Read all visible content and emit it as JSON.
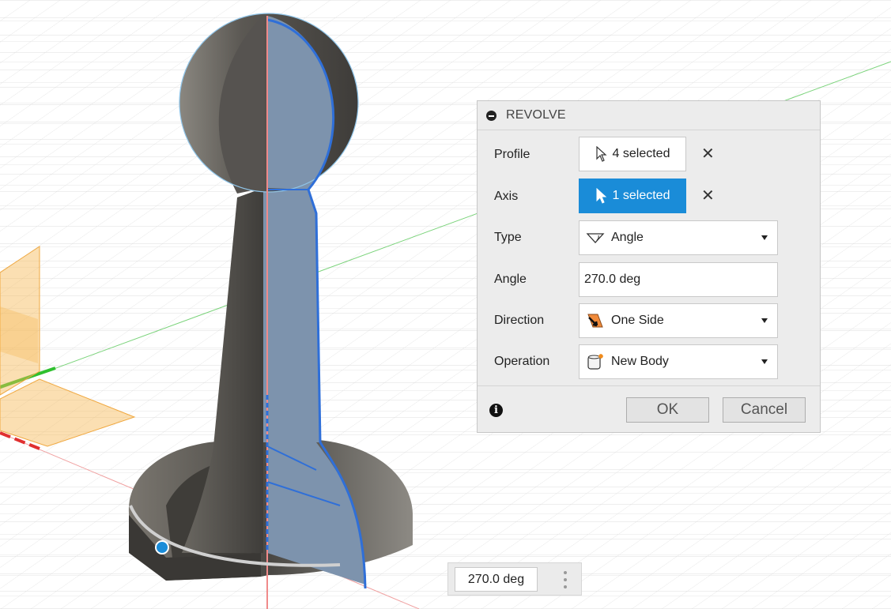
{
  "revolve": {
    "title": "REVOLVE",
    "profile": {
      "label": "Profile",
      "value": "4 selected"
    },
    "axis": {
      "label": "Axis",
      "value": "1 selected"
    },
    "type": {
      "label": "Type",
      "value": "Angle"
    },
    "angle": {
      "label": "Angle",
      "value": "270.0 deg"
    },
    "direction": {
      "label": "Direction",
      "value": "One Side"
    },
    "operation": {
      "label": "Operation",
      "value": "New Body"
    },
    "ok_label": "OK",
    "cancel_label": "Cancel"
  },
  "hud": {
    "angle_value": "270.0 deg"
  },
  "colors": {
    "accent": "#1a8cd8",
    "body": "#5a5752",
    "selected_face": "#7d93ad",
    "selection_edge": "#2f6fd8",
    "x_axis": "#e03030",
    "y_axis": "#2fc02f",
    "plane": "#f7b754"
  },
  "icons": {
    "profile": "cursor-arrow-icon",
    "axis": "cursor-arrow-icon",
    "type": "angle-icon",
    "direction": "one-side-direction-icon",
    "operation": "new-body-icon",
    "info": "info-icon"
  }
}
